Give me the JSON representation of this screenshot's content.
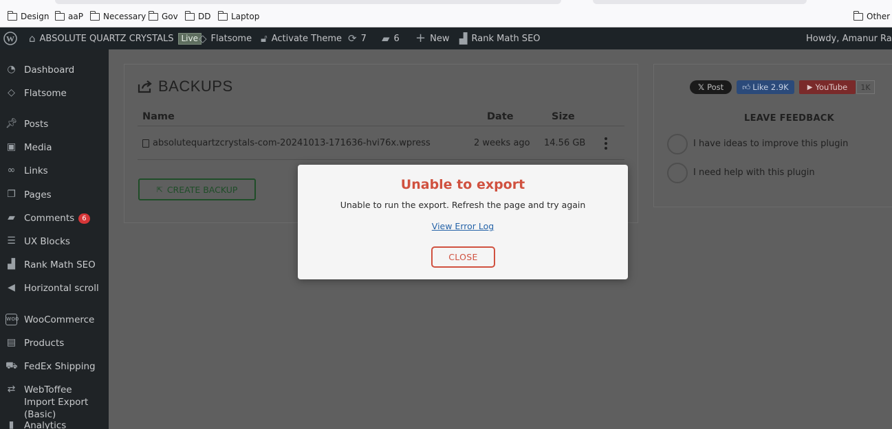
{
  "bookmarks": {
    "items": [
      "Design",
      "aaP",
      "Necessary",
      "Gov",
      "DD",
      "Laptop"
    ],
    "other": "Other B"
  },
  "adminbar": {
    "site_name": "ABSOLUTE QUARTZ CRYSTALS",
    "live_badge": "Live",
    "theme": "Flatsome",
    "activate_theme": "Activate Theme",
    "updates_count": "7",
    "comments_count": "6",
    "new_label": "New",
    "seo_label": "Rank Math SEO",
    "howdy": "Howdy, Amanur Rahm"
  },
  "sidebar": {
    "items": [
      {
        "label": "Dashboard",
        "icon": "dashboard-icon"
      },
      {
        "label": "Flatsome",
        "icon": "flatsome-icon"
      },
      {
        "label": "Posts",
        "icon": "pin-icon"
      },
      {
        "label": "Media",
        "icon": "media-icon"
      },
      {
        "label": "Links",
        "icon": "link-icon"
      },
      {
        "label": "Pages",
        "icon": "pages-icon"
      },
      {
        "label": "Comments",
        "icon": "comment-icon",
        "count": "6"
      },
      {
        "label": "UX Blocks",
        "icon": "blocks-icon"
      },
      {
        "label": "Rank Math SEO",
        "icon": "chart-icon"
      },
      {
        "label": "Horizontal scroll",
        "icon": "megaphone-icon"
      },
      {
        "label": "WooCommerce",
        "icon": "woo-icon"
      },
      {
        "label": "Products",
        "icon": "archive-icon"
      },
      {
        "label": "FedEx Shipping",
        "icon": "truck-icon"
      },
      {
        "label": "WebToffee Import Export (Basic)",
        "icon": "sync-icon"
      },
      {
        "label": "Analytics",
        "icon": "analytics-icon"
      }
    ]
  },
  "backups": {
    "title": "BACKUPS",
    "columns": [
      "Name",
      "Date",
      "Size"
    ],
    "rows": [
      {
        "name": "absolutequartzcrystals-com-20241013-171636-hvi76x.wpress",
        "date": "2 weeks ago",
        "size": "14.56 GB"
      }
    ],
    "create_button": "CREATE BACKUP"
  },
  "social": {
    "x_post": "Post",
    "fb_like": "Like 2.9K",
    "youtube": "YouTube",
    "youtube_count": "1K"
  },
  "feedback": {
    "title": "LEAVE FEEDBACK",
    "options": [
      "I have ideas to improve this plugin",
      "I need help with this plugin"
    ]
  },
  "modal": {
    "title": "Unable to export",
    "message": "Unable to run the export. Refresh the page and try again",
    "link": "View Error Log",
    "close": "CLOSE"
  },
  "colors": {
    "modal_accent": "#d0513f",
    "admin_bar": "#1d2327",
    "overlay_bg": "#5f5f5f"
  }
}
